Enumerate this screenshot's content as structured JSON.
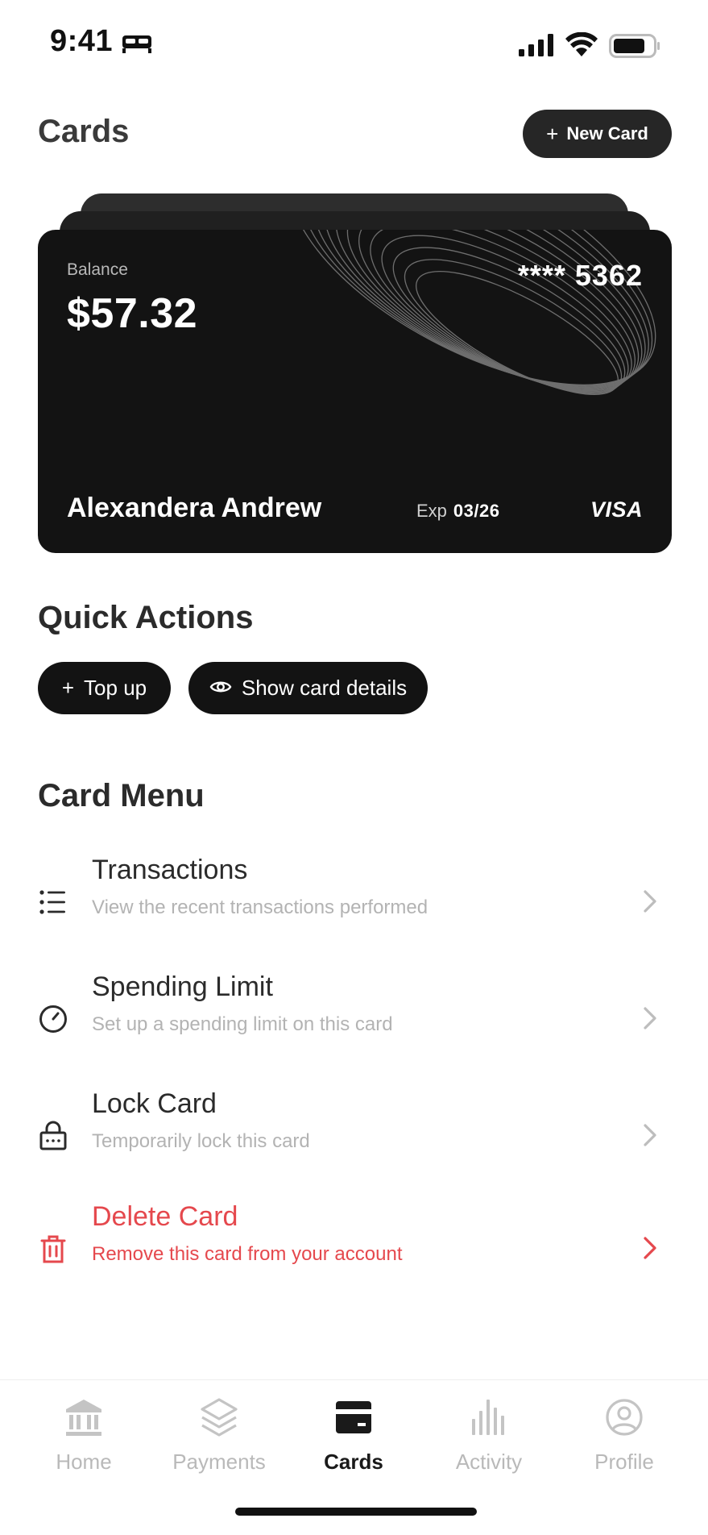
{
  "status_bar": {
    "time": "9:41"
  },
  "header": {
    "title": "Cards",
    "new_card_label": "New Card"
  },
  "card": {
    "balance_label": "Balance",
    "balance": "$57.32",
    "number": "**** 5362",
    "holder": "Alexandera Andrew",
    "exp_label": "Exp",
    "exp": "03/26",
    "network": "VISA"
  },
  "quick_actions": {
    "title": "Quick Actions",
    "top_up": "Top up",
    "show_details": "Show card details"
  },
  "card_menu": {
    "title": "Card Menu",
    "items": [
      {
        "label": "Transactions",
        "sub": "View the recent transactions performed",
        "icon": "list-icon"
      },
      {
        "label": "Spending Limit",
        "sub": "Set up a spending limit on this card",
        "icon": "gauge-icon"
      },
      {
        "label": "Lock Card",
        "sub": "Temporarily lock this card",
        "icon": "lock-icon"
      },
      {
        "label": "Delete Card",
        "sub": "Remove this card from your account",
        "icon": "trash-icon"
      }
    ]
  },
  "tabs": [
    {
      "label": "Home",
      "icon": "bank-icon"
    },
    {
      "label": "Payments",
      "icon": "layers-icon"
    },
    {
      "label": "Cards",
      "icon": "card-icon",
      "active": true
    },
    {
      "label": "Activity",
      "icon": "bars-icon"
    },
    {
      "label": "Profile",
      "icon": "user-circle-icon"
    }
  ],
  "colors": {
    "danger": "#e5484d",
    "dark": "#131313",
    "muted": "#b3b3b3"
  }
}
